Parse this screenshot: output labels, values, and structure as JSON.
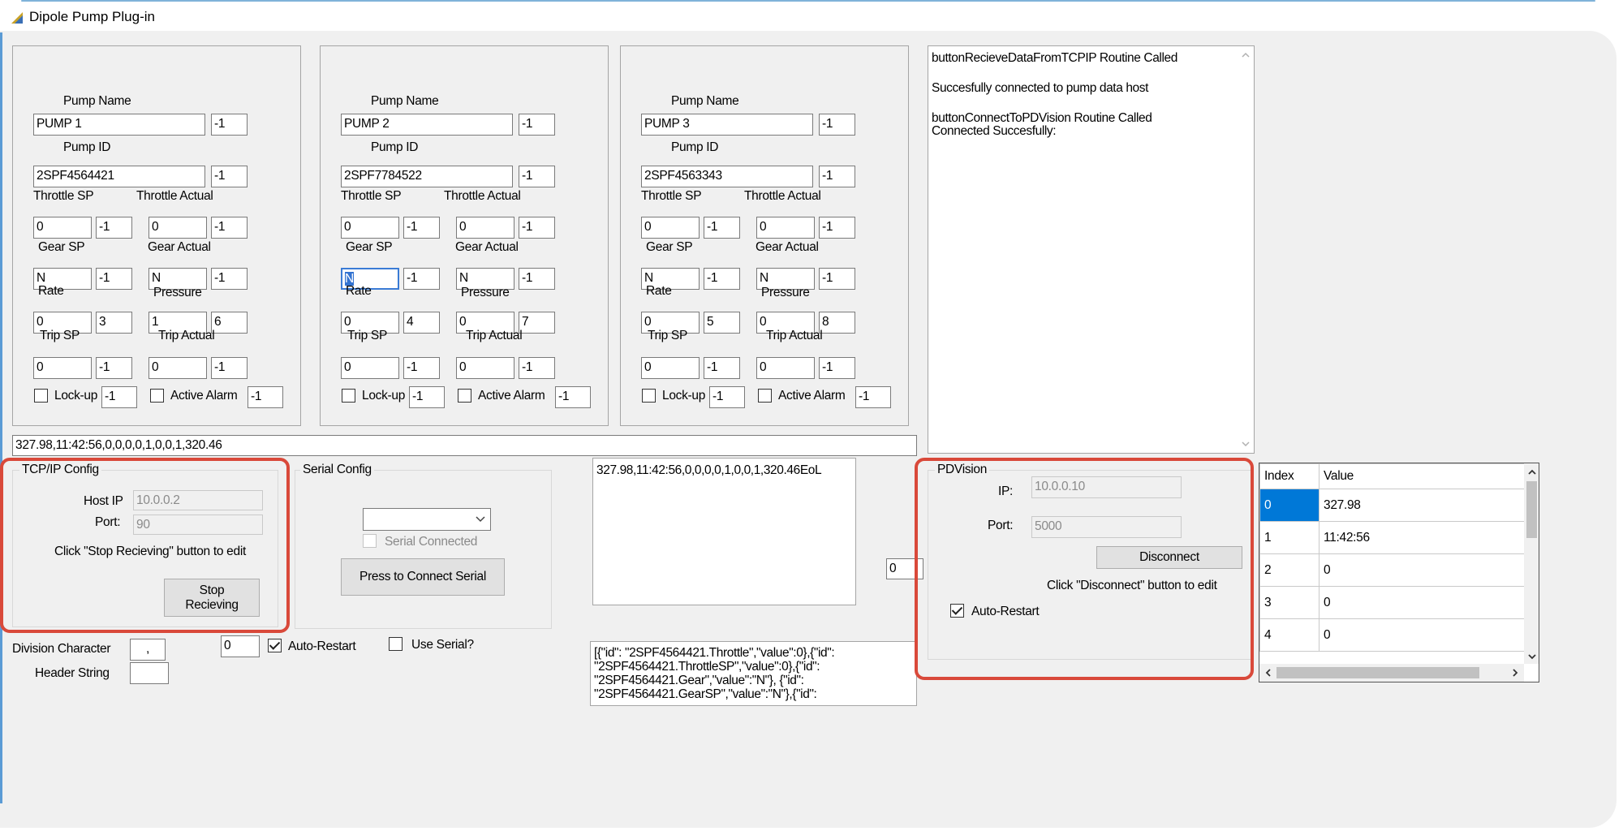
{
  "window": {
    "title": "Dipole Pump Plug-in"
  },
  "pump_labels": {
    "name": "Pump Name",
    "id": "Pump ID",
    "throttle_sp": "Throttle SP",
    "throttle_actual": "Throttle Actual",
    "gear_sp": "Gear SP",
    "gear_actual": "Gear Actual",
    "rate": "Rate",
    "pressure": "Pressure",
    "trip_sp": "Trip SP",
    "trip_actual": "Trip Actual",
    "lockup": "Lock-up",
    "active_alarm": "Active Alarm"
  },
  "pumps": [
    {
      "name": "PUMP 1",
      "name_idx": "-1",
      "id": "2SPF4564421",
      "id_idx": "-1",
      "throttle_sp": "0",
      "throttle_sp_idx": "-1",
      "throttle_actual": "0",
      "throttle_actual_idx": "-1",
      "gear_sp": "N",
      "gear_sp_idx": "-1",
      "gear_actual": "N",
      "gear_actual_idx": "-1",
      "rate": "0",
      "rate_idx": "3",
      "pressure": "1",
      "pressure_idx": "6",
      "trip_sp": "0",
      "trip_sp_idx": "-1",
      "trip_actual": "0",
      "trip_actual_idx": "-1",
      "lockup_idx": "-1",
      "active_alarm_idx": "-1"
    },
    {
      "name": "PUMP 2",
      "name_idx": "-1",
      "id": "2SPF7784522",
      "id_idx": "-1",
      "throttle_sp": "0",
      "throttle_sp_idx": "-1",
      "throttle_actual": "0",
      "throttle_actual_idx": "-1",
      "gear_sp": "N",
      "gear_sp_idx": "-1",
      "gear_actual": "N",
      "gear_actual_idx": "-1",
      "rate": "0",
      "rate_idx": "4",
      "pressure": "0",
      "pressure_idx": "7",
      "trip_sp": "0",
      "trip_sp_idx": "-1",
      "trip_actual": "0",
      "trip_actual_idx": "-1",
      "lockup_idx": "-1",
      "active_alarm_idx": "-1"
    },
    {
      "name": "PUMP 3",
      "name_idx": "-1",
      "id": "2SPF4563343",
      "id_idx": "-1",
      "throttle_sp": "0",
      "throttle_sp_idx": "-1",
      "throttle_actual": "0",
      "throttle_actual_idx": "-1",
      "gear_sp": "N",
      "gear_sp_idx": "-1",
      "gear_actual": "N",
      "gear_actual_idx": "-1",
      "rate": "0",
      "rate_idx": "5",
      "pressure": "0",
      "pressure_idx": "8",
      "trip_sp": "0",
      "trip_sp_idx": "-1",
      "trip_actual": "0",
      "trip_actual_idx": "-1",
      "lockup_idx": "-1",
      "active_alarm_idx": "-1"
    }
  ],
  "log": {
    "lines": [
      "buttonRecieveDataFromTCPIP Routine Called",
      "Succesfully connected to pump data host",
      "buttonConnectToPDVision Routine Called",
      "Connected Succesfully:"
    ]
  },
  "raw_data": "327.98,11:42:56,0,0,0,0,1,0,0,1,320.46",
  "raw_data_eol": "327.98,11:42:56,0,0,0,0,1,0,0,1,320.46EoL",
  "tcpip": {
    "title": "TCP/IP Config",
    "host_label": "Host IP",
    "host": "10.0.0.2",
    "port_label": "Port:",
    "port": "90",
    "hint": "Click \"Stop Recieving\" button to edit",
    "stop_line1": "Stop",
    "stop_line2": "Recieving"
  },
  "serial": {
    "title": "Serial Config",
    "port_selected": "",
    "connected_label": "Serial Connected",
    "connect_button": "Press to Connect Serial"
  },
  "options": {
    "division_label": "Division Character",
    "division_value": ",",
    "header_label": "Header String",
    "header_value": "",
    "auto_restart_value": "0",
    "auto_restart_label": "Auto-Restart",
    "auto_restart_checked": true,
    "use_serial_label": "Use Serial?",
    "use_serial_checked": false
  },
  "json_preview": {
    "lines": [
      "[{\"id\": \"2SPF4564421.Throttle\",\"value\":0},{\"id\":",
      "\"2SPF4564421.ThrottleSP\",\"value\":0},{\"id\":",
      "\"2SPF4564421.Gear\",\"value\":\"N\"}, {\"id\":",
      "\"2SPF4564421.GearSP\",\"value\":\"N\"},{\"id\":"
    ]
  },
  "small_value": "0",
  "pdvision": {
    "title": "PDVision",
    "ip_label": "IP:",
    "ip": "10.0.0.10",
    "port_label": "Port:",
    "port": "5000",
    "disconnect_button": "Disconnect",
    "hint": "Click \"Disconnect\" button to edit",
    "auto_restart_label": "Auto-Restart",
    "auto_restart_checked": true
  },
  "grid": {
    "headers": [
      "Index",
      "Value"
    ],
    "rows": [
      {
        "index": "0",
        "value": "327.98"
      },
      {
        "index": "1",
        "value": "11:42:56"
      },
      {
        "index": "2",
        "value": "0"
      },
      {
        "index": "3",
        "value": "0"
      },
      {
        "index": "4",
        "value": "0"
      }
    ],
    "selected_row": 0
  },
  "colors": {
    "highlight": "#d9493a",
    "selection": "#0078d7",
    "focus": "#3a7bd5"
  }
}
